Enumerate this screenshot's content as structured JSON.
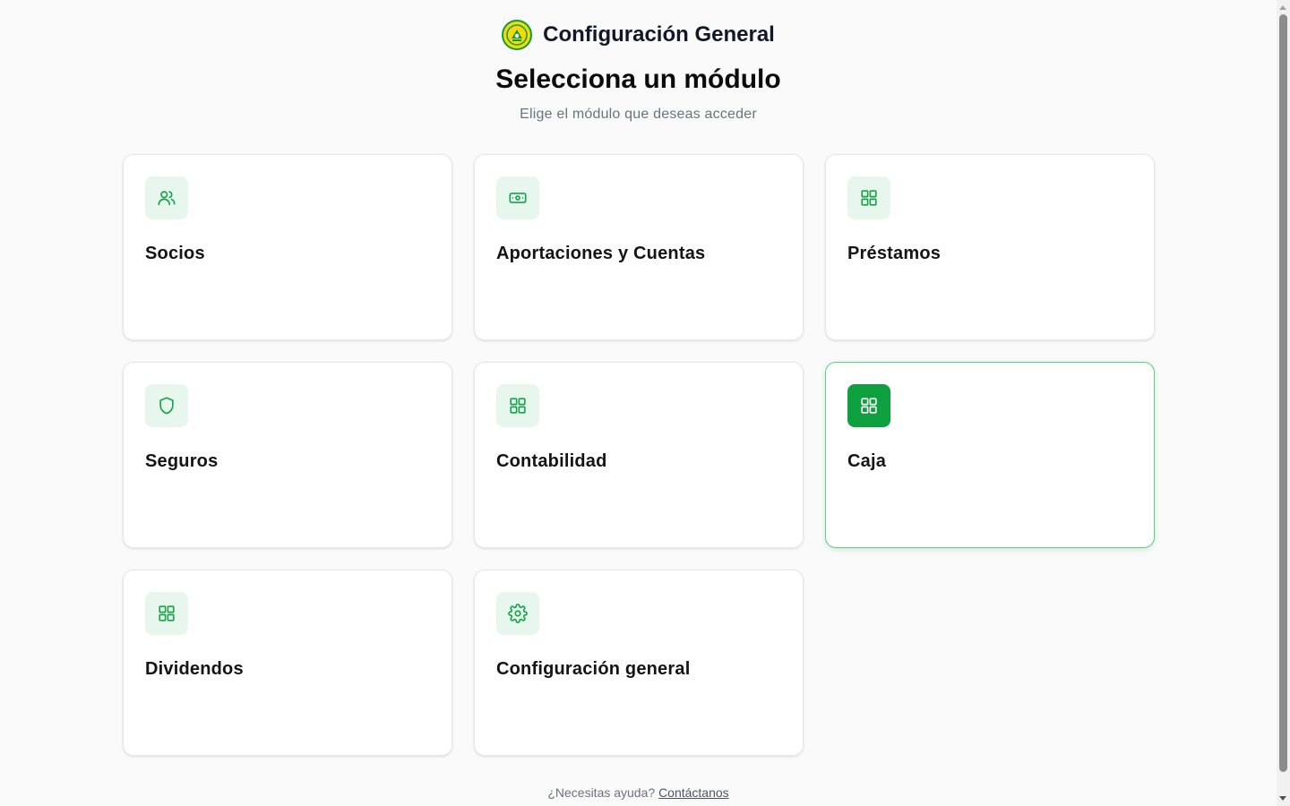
{
  "header": {
    "logo_icon": "cooperative-logo-icon",
    "title": "Configuración General"
  },
  "main": {
    "title": "Selecciona un módulo",
    "subtitle": "Elige el módulo que deseas acceder"
  },
  "modules": [
    {
      "label": "Socios",
      "icon": "users-icon",
      "active": false
    },
    {
      "label": "Aportaciones y Cuentas",
      "icon": "banknote-icon",
      "active": false
    },
    {
      "label": "Préstamos",
      "icon": "grid-icon",
      "active": false
    },
    {
      "label": "Seguros",
      "icon": "shield-icon",
      "active": false
    },
    {
      "label": "Contabilidad",
      "icon": "grid-icon",
      "active": false
    },
    {
      "label": "Caja",
      "icon": "grid-icon",
      "active": true
    },
    {
      "label": "Dividendos",
      "icon": "grid-icon",
      "active": false
    },
    {
      "label": "Configuración general",
      "icon": "gear-icon",
      "active": false
    }
  ],
  "footer": {
    "help_text": "¿Necesitas ayuda?",
    "contact_link": "Contáctanos"
  },
  "colors": {
    "accent": "#16a34a",
    "accent_dark": "#0e9f3e",
    "icon_bg": "#e8f7ee",
    "background": "#fafafa"
  }
}
